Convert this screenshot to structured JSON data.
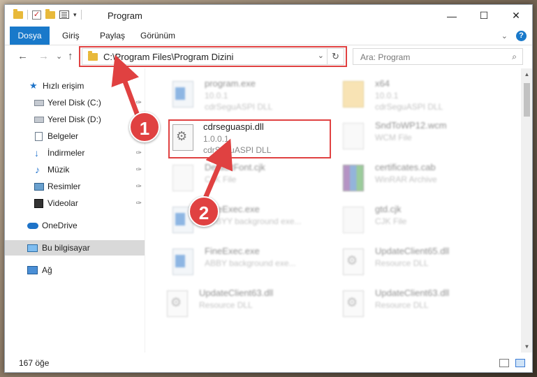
{
  "window": {
    "title": "Program",
    "controls": {
      "minimize": "—",
      "maximize": "☐",
      "close": "✕"
    }
  },
  "ribbon": {
    "tabs": [
      "Dosya",
      "Giriş",
      "Paylaş",
      "Görünüm"
    ],
    "expand_glyph": "⌄",
    "help_glyph": "?"
  },
  "navigation": {
    "back": "←",
    "forward": "→",
    "recent": "⌄",
    "up": "↑",
    "address": "C:\\Program Files\\Program Dizini",
    "dropdown": "⌄",
    "refresh": "↻",
    "search_placeholder": "Ara: Program",
    "search_icon": "⌕"
  },
  "sidebar": {
    "items": [
      {
        "label": "Hızlı erişim",
        "icon": "star-icon"
      },
      {
        "label": "Yerel Disk (C:)",
        "icon": "disk-icon",
        "pinned": true
      },
      {
        "label": "Yerel Disk (D:)",
        "icon": "disk-icon",
        "pinned": true
      },
      {
        "label": "Belgeler",
        "icon": "document-icon",
        "pinned": true
      },
      {
        "label": "İndirmeler",
        "icon": "download-icon",
        "pinned": true
      },
      {
        "label": "Müzik",
        "icon": "music-icon",
        "pinned": true
      },
      {
        "label": "Resimler",
        "icon": "picture-icon",
        "pinned": true
      },
      {
        "label": "Videolar",
        "icon": "video-icon",
        "pinned": true
      },
      {
        "label": "OneDrive",
        "icon": "cloud-icon"
      },
      {
        "label": "Bu bilgisayar",
        "icon": "computer-icon",
        "selected": true
      },
      {
        "label": "Ağ",
        "icon": "network-icon"
      }
    ],
    "pin_glyph": "📌"
  },
  "files": [
    {
      "name": "program.exe",
      "line1": "10.0.1",
      "line2": "cdrSeguASPI DLL",
      "icon": "program-icon"
    },
    {
      "name": "x64",
      "line1": "10.0.1",
      "line2": "cdrSeguASPI DLL",
      "icon": "folder-icon"
    },
    {
      "name": "cdrseguaspi.dll",
      "line1": "1.0.0.1",
      "line2": "cdrSeguASPI DLL",
      "icon": "dll-icon",
      "highlighted": true
    },
    {
      "name": "SndToWP12.wcm",
      "line1": "WCM File",
      "line2": "",
      "icon": "file-icon"
    },
    {
      "name": "DefaultFont.cjk",
      "line1": "CJK File",
      "line2": "",
      "icon": "file-icon"
    },
    {
      "name": "certificates.cab",
      "line1": "WinRAR Archive",
      "line2": "",
      "icon": "archive-icon"
    },
    {
      "name": "FineExec.exe",
      "line1": "ABBYY background exe...",
      "line2": "",
      "icon": "exe-icon"
    },
    {
      "name": "gtd.cjk",
      "line1": "CJK File",
      "line2": "",
      "icon": "file-icon"
    },
    {
      "name": "FineExec.exe",
      "line1": "ABBY background exe...",
      "line2": "",
      "icon": "exe-icon"
    },
    {
      "name": "UpdateClient65.dll",
      "line1": "Resource DLL",
      "line2": "",
      "icon": "dll-icon"
    },
    {
      "name": "UpdateClient63.dll",
      "line1": "Resource DLL",
      "line2": "",
      "icon": "dll-icon"
    },
    {
      "name": "UpdateClient63.dll",
      "line1": "Resource DLL",
      "line2": "",
      "icon": "dll-icon"
    }
  ],
  "status": {
    "item_count": "167 öğe"
  },
  "annotations": {
    "step1": "1",
    "step2": "2",
    "color": "#e04141"
  }
}
